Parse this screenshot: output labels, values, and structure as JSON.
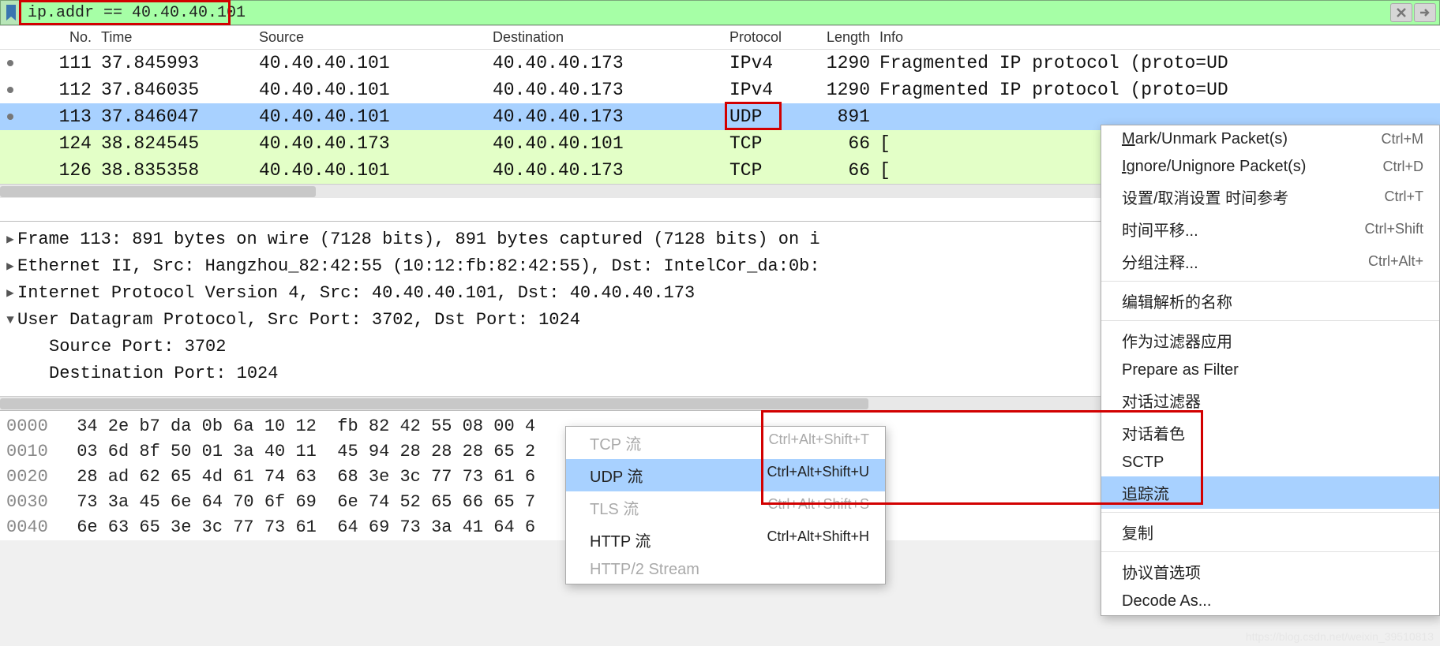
{
  "filter": {
    "expression": "ip.addr == 40.40.40.101"
  },
  "columns": {
    "no": "No.",
    "time": "Time",
    "source": "Source",
    "destination": "Destination",
    "protocol": "Protocol",
    "length": "Length",
    "info": "Info"
  },
  "packets": [
    {
      "no": "111",
      "time": "37.845993",
      "src": "40.40.40.101",
      "dst": "40.40.40.173",
      "proto": "IPv4",
      "len": "1290",
      "info": "Fragmented IP protocol (proto=UD",
      "dot": true,
      "cls": ""
    },
    {
      "no": "112",
      "time": "37.846035",
      "src": "40.40.40.101",
      "dst": "40.40.40.173",
      "proto": "IPv4",
      "len": "1290",
      "info": "Fragmented IP protocol (proto=UD",
      "dot": true,
      "cls": ""
    },
    {
      "no": "113",
      "time": "37.846047",
      "src": "40.40.40.101",
      "dst": "40.40.40.173",
      "proto": "UDP",
      "len": "891",
      "info": "",
      "dot": true,
      "cls": "row-sel"
    },
    {
      "no": "124",
      "time": "38.824545",
      "src": "40.40.40.173",
      "dst": "40.40.40.101",
      "proto": "TCP",
      "len": "66",
      "info": "[",
      "dot": false,
      "cls": "row-green"
    },
    {
      "no": "126",
      "time": "38.835358",
      "src": "40.40.40.101",
      "dst": "40.40.40.173",
      "proto": "TCP",
      "len": "66",
      "info": "[",
      "dot": false,
      "cls": "row-green"
    }
  ],
  "details": [
    {
      "exp": ">",
      "text": "Frame 113: 891 bytes on wire (7128 bits), 891 bytes captured (7128 bits) on i"
    },
    {
      "exp": ">",
      "text": "Ethernet II, Src: Hangzhou_82:42:55 (10:12:fb:82:42:55), Dst: IntelCor_da:0b:"
    },
    {
      "exp": ">",
      "text": "Internet Protocol Version 4, Src: 40.40.40.101, Dst: 40.40.40.173"
    },
    {
      "exp": "v",
      "text": "User Datagram Protocol, Src Port: 3702, Dst Port: 1024"
    },
    {
      "exp": "",
      "text": "Source Port: 3702",
      "indent": true
    },
    {
      "exp": "",
      "text": "Destination Port: 1024",
      "indent": true
    }
  ],
  "hex": [
    {
      "off": "0000",
      "bytes": "34 2e b7 da 0b 6a 10 12  fb 82 42 55 08 00 4"
    },
    {
      "off": "0010",
      "bytes": "03 6d 8f 50 01 3a 40 11  45 94 28 28 28 65 2"
    },
    {
      "off": "0020",
      "bytes": "28 ad 62 65 4d 61 74 63  68 3e 3c 77 73 61 6"
    },
    {
      "off": "0030",
      "bytes": "73 3a 45 6e 64 70 6f 69  6e 74 52 65 66 65 7"
    },
    {
      "off": "0040",
      "bytes": "6e 63 65 3e 3c 77 73 61  64 69 73 3a 41 64 6"
    }
  ],
  "ctx": {
    "mark": "Mark/Unmark Packet(s)",
    "mark_sc": "Ctrl+M",
    "ignore": "Ignore/Unignore Packet(s)",
    "ignore_sc": "Ctrl+D",
    "timeref": "设置/取消设置 时间参考",
    "timeref_sc": "Ctrl+T",
    "timeshift": "时间平移...",
    "timeshift_sc": "Ctrl+Shift",
    "comment": "分组注释...",
    "comment_sc": "Ctrl+Alt+",
    "editname": "编辑解析的名称",
    "applyfilter": "作为过滤器应用",
    "prepfilter": "Prepare as Filter",
    "convfilter": "对话过滤器",
    "convcolor": "对话着色",
    "sctp": "SCTP",
    "follow": "追踪流",
    "copy": "复制",
    "protoprefs": "协议首选项",
    "decodeas": "Decode As..."
  },
  "sub": {
    "tcp": "TCP 流",
    "tcp_sc": "Ctrl+Alt+Shift+T",
    "udp": "UDP 流",
    "udp_sc": "Ctrl+Alt+Shift+U",
    "tls": "TLS 流",
    "tls_sc": "Ctrl+Alt+Shift+S",
    "http": "HTTP 流",
    "http_sc": "Ctrl+Alt+Shift+H",
    "http2": "HTTP/2 Stream"
  },
  "mark_letters": {
    "m": "M",
    "i": "I"
  },
  "watermark": "https://blog.csdn.net/weixin_39510813"
}
